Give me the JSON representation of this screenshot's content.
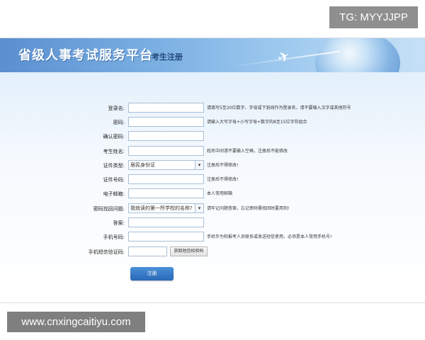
{
  "watermarks": {
    "top_badge": "TG: MYYJJPP",
    "bottom_badge": "www.cnxingcaitiyu.com"
  },
  "header": {
    "title": "省级人事考试服务平台"
  },
  "form": {
    "title": "考生注册",
    "fields": {
      "username": {
        "label": "登录名:",
        "value": "",
        "hint": "请填写5至20位数字、字母或下划线作为登录名，请不要输入汉字或其他符号"
      },
      "password": {
        "label": "密码:",
        "value": "",
        "hint": "请输入大写字母+小写字母+数字的8至15位字符组合"
      },
      "confirm_password": {
        "label": "确认密码:",
        "value": ""
      },
      "real_name": {
        "label": "考生姓名:",
        "value": "",
        "hint": "姓名中间请不要输入空格，注册后不能修改"
      },
      "id_type": {
        "label": "证件类型:",
        "selected": "居民身份证",
        "hint": "注册后不得修改!"
      },
      "id_number": {
        "label": "证件号码:",
        "value": "",
        "hint": "注册后不得修改!"
      },
      "email": {
        "label": "电子邮箱:",
        "value": "",
        "hint": "本人常用邮箱"
      },
      "security_question": {
        "label": "密码找回问题:",
        "selected": "我就读的第一所学校的名称?",
        "hint": "请牢记问题答案，忘记密码需找回时要用到!"
      },
      "security_answer": {
        "label": "答案:",
        "value": ""
      },
      "mobile": {
        "label": "手机号码:",
        "value": "",
        "hint": "手机作为和报考人员联系或发送短信使用，必须是本人常用手机号!"
      },
      "sms_code": {
        "label": "手机短信验证码:",
        "value": "",
        "button": "获取短信校验码"
      }
    },
    "submit_label": "注册"
  },
  "colors": {
    "banner_start": "#5a8fd0",
    "banner_end": "#c6e1f6",
    "button_blue": "#2a69b6",
    "form_title": "#234a7a"
  }
}
